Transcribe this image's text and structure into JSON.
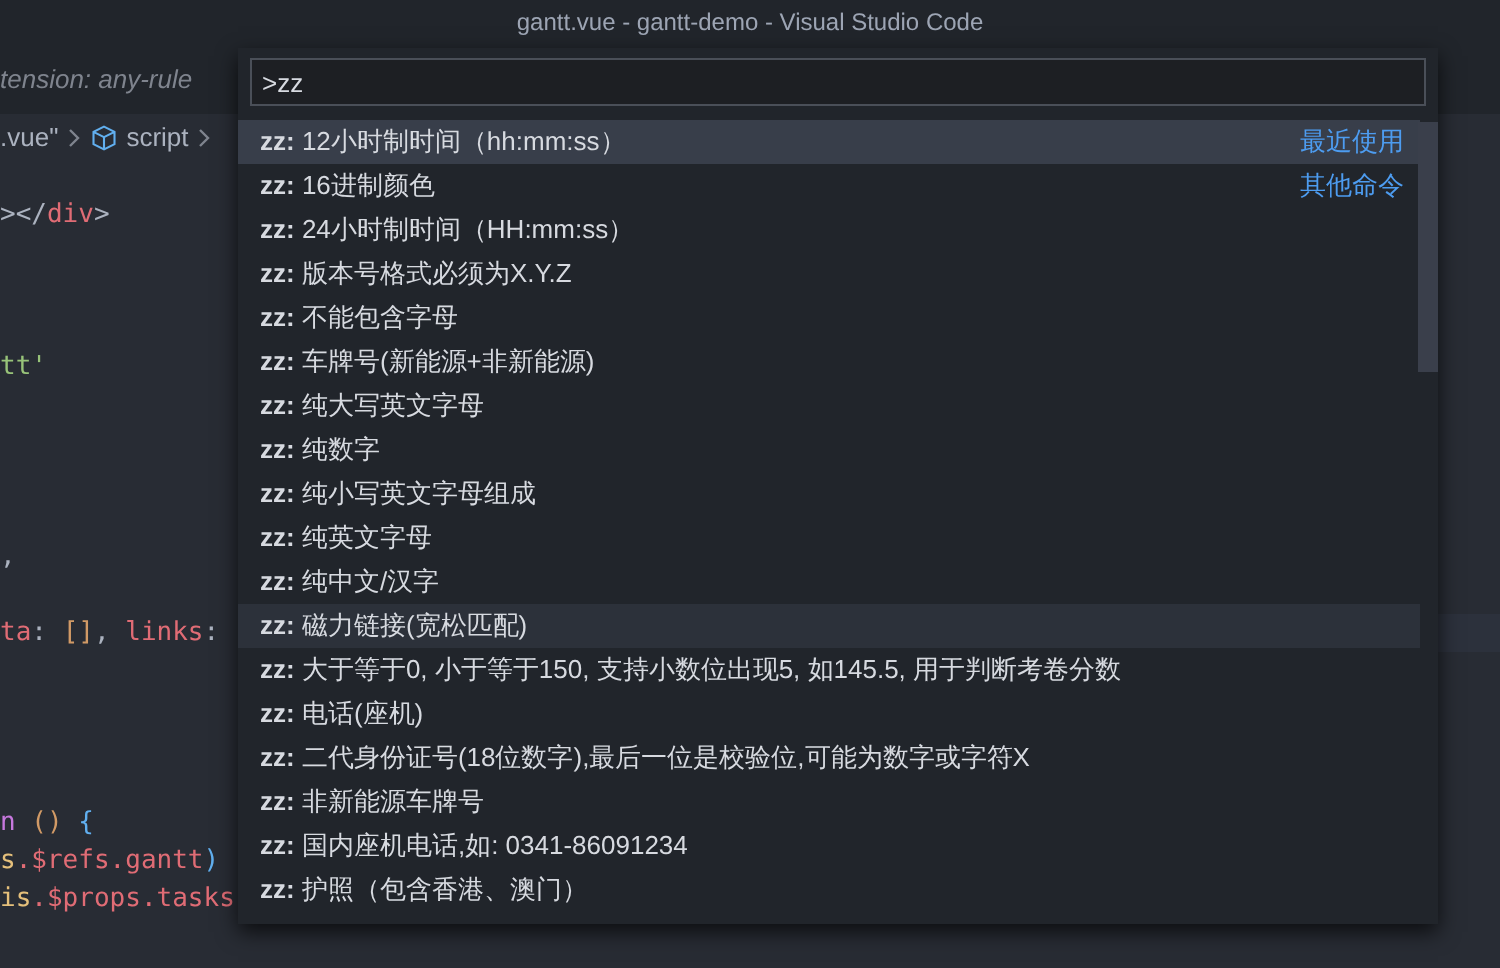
{
  "window": {
    "title": "gantt.vue - gantt-demo - Visual Studio Code"
  },
  "tab": {
    "label": "tension: any-rule"
  },
  "breadcrumb": [
    {
      "label": ".vue\""
    },
    {
      "label": "script",
      "kind": "script"
    }
  ],
  "editor": {
    "lines": [
      [
        {
          "text": ">",
          "color": "#abb2bf"
        },
        {
          "text": "</",
          "color": "#abb2bf"
        },
        {
          "text": "div",
          "color": "#e06c75"
        },
        {
          "text": ">",
          "color": "#abb2bf"
        }
      ],
      [
        {
          "text": "tt'",
          "color": "#98c379"
        }
      ],
      [
        {
          "text": ",",
          "color": "#abb2bf"
        }
      ],
      [
        {
          "text": "ta",
          "color": "#e06c75"
        },
        {
          "text": ": ",
          "color": "#abb2bf"
        },
        {
          "text": "[]",
          "color": "#d19a66"
        },
        {
          "text": ", ",
          "color": "#abb2bf"
        },
        {
          "text": "links",
          "color": "#e06c75"
        },
        {
          "text": ":",
          "color": "#abb2bf"
        }
      ],
      [
        {
          "text": "n ",
          "color": "#c678dd"
        },
        {
          "text": "() ",
          "color": "#d19a66"
        },
        {
          "text": "{",
          "color": "#61afef"
        }
      ],
      [
        {
          "text": "s",
          "color": "#e5c07b"
        },
        {
          "text": ".$refs.gantt",
          "color": "#e06c75"
        },
        {
          "text": ")",
          "color": "#61afef"
        }
      ],
      [
        {
          "text": "is",
          "color": "#e5c07b"
        },
        {
          "text": ".$props.tasks",
          "color": "#e06c75"
        }
      ]
    ]
  },
  "command_palette": {
    "value": ">zz",
    "items": [
      {
        "label": "**zz:** 12小时制时间（hh:mm:ss）",
        "detail": "最近使用",
        "selected": true
      },
      {
        "label": "**zz:** 16进制颜色",
        "detail": "其他命令",
        "selected": false
      },
      {
        "label": "**zz:** 24小时制时间（HH:mm:ss）",
        "selected": false
      },
      {
        "label": "**zz:** 版本号格式必须为X.Y.Z",
        "selected": false
      },
      {
        "label": "**zz:** 不能包含字母",
        "selected": false
      },
      {
        "label": "**zz:** 车牌号(新能源+非新能源)",
        "selected": false
      },
      {
        "label": "**zz:** 纯大写英文字母",
        "selected": false
      },
      {
        "label": "**zz:** 纯数字",
        "selected": false
      },
      {
        "label": "**zz:** 纯小写英文字母组成",
        "selected": false
      },
      {
        "label": "**zz:** 纯英文字母",
        "selected": false
      },
      {
        "label": "**zz:** 纯中文/汉字",
        "selected": false
      },
      {
        "label": "**zz:** 磁力链接(宽松匹配)",
        "selected": false,
        "hovered": true
      },
      {
        "label": "**zz:** 大于等于0, 小于等于150, 支持小数位出现5, 如145.5, 用于判断考卷分数",
        "selected": false
      },
      {
        "label": "**zz:** 电话(座机)",
        "selected": false
      },
      {
        "label": "**zz:** 二代身份证号(18位数字),最后一位是校验位,可能为数字或字符X",
        "selected": false
      },
      {
        "label": "**zz:** 非新能源车牌号",
        "selected": false
      },
      {
        "label": "**zz:** 国内座机电话,如: 0341-86091234",
        "selected": false
      },
      {
        "label": "**zz:** 护照（包含香港、澳门）",
        "selected": false
      }
    ]
  }
}
